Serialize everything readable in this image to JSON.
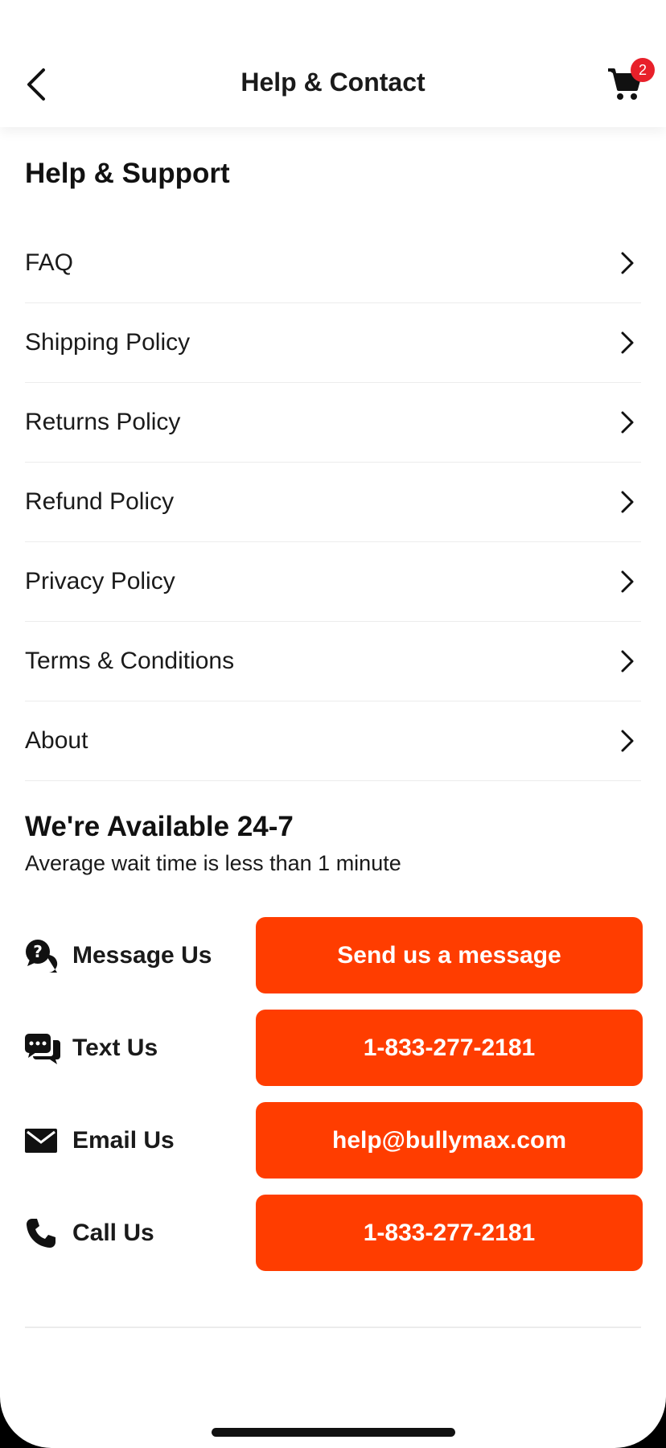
{
  "header": {
    "title": "Help & Contact",
    "back_icon": "chevron-left-icon",
    "cart_icon": "cart-icon",
    "cart_count": "2"
  },
  "support": {
    "title": "Help & Support",
    "items": [
      {
        "label": "FAQ"
      },
      {
        "label": "Shipping Policy"
      },
      {
        "label": "Returns Policy"
      },
      {
        "label": "Refund Policy"
      },
      {
        "label": "Privacy Policy"
      },
      {
        "label": "Terms & Conditions"
      },
      {
        "label": "About"
      }
    ]
  },
  "availability": {
    "title": "We're Available 24-7",
    "subtitle": "Average wait time is less than 1 minute"
  },
  "contacts": [
    {
      "icon": "chat-question-icon",
      "label": "Message Us",
      "button": "Send us a message"
    },
    {
      "icon": "sms-icon",
      "label": "Text Us",
      "button": "1-833-277-2181"
    },
    {
      "icon": "envelope-icon",
      "label": "Email Us",
      "button": "help@bullymax.com"
    },
    {
      "icon": "phone-icon",
      "label": "Call Us",
      "button": "1-833-277-2181"
    }
  ],
  "colors": {
    "accent": "#ff3d00",
    "badge": "#e8202a",
    "text": "#1a1a1a"
  }
}
